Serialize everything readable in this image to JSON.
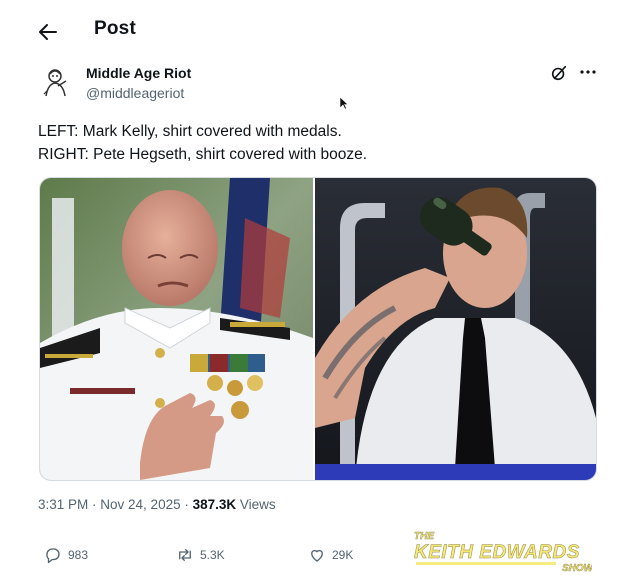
{
  "header": {
    "title": "Post",
    "back_icon": "arrow-left-icon"
  },
  "author": {
    "name": "Middle Age Riot",
    "handle": "@middleageriot",
    "avatar": "cartoon-man-avatar"
  },
  "tweet": {
    "line1": "LEFT: Mark Kelly, shirt covered with medals.",
    "line2": "RIGHT: Pete Hegseth, shirt covered with booze."
  },
  "meta": {
    "time": "3:31 PM",
    "sep1": " · ",
    "date": "Nov 24, 2025",
    "sep2": " · ",
    "views_count": "387.3K",
    "views_label": " Views"
  },
  "actions": {
    "replies": "983",
    "reposts": "5.3K",
    "likes": "29K"
  },
  "watermark": {
    "line1": "THE",
    "line2": "KEITH EDWARDS",
    "line3": "SHOW"
  },
  "colors": {
    "text": "#0f1419",
    "muted": "#536471",
    "watermark": "#f5e663"
  }
}
